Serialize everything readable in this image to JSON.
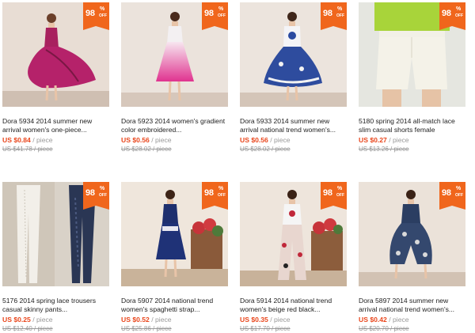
{
  "badge": {
    "number": "98",
    "percent": "%",
    "off": "OFF"
  },
  "unit": "/ piece",
  "products": [
    {
      "title": "Dora 5934 2014 summer new\narrival women's one-piece...",
      "price": "US $0.84",
      "original": "US $41.78 / piece",
      "garment": "magenta-dress"
    },
    {
      "title": "Dora 5923 2014 women's gradient\ncolor embroidered...",
      "price": "US $0.56",
      "original": "US $28.02 / piece",
      "garment": "pink-gradient-dress"
    },
    {
      "title": "Dora 5933 2014 summer new\narrival national trend women's...",
      "price": "US $0.56",
      "original": "US $28.02 / piece",
      "garment": "blue-print-skirt"
    },
    {
      "title": "5180 spring 2014 all-match lace\nslim casual shorts female",
      "price": "US $0.27",
      "original": "US $13.26 / piece",
      "garment": "white-shorts"
    },
    {
      "title": "5176 2014 spring lace trousers\ncasual skinny pants...",
      "price": "US $0.25",
      "original": "US $12.40 / piece",
      "garment": "skinny-pants"
    },
    {
      "title": "Dora 5907 2014 national trend\nwomen's spaghetti strap...",
      "price": "US $0.52",
      "original": "US $25.86 / piece",
      "garment": "navy-strap-dress"
    },
    {
      "title": "Dora 5914 2014 national trend\nwomen's beige red black...",
      "price": "US $0.35",
      "original": "US $17.70 / piece",
      "garment": "red-print-pants"
    },
    {
      "title": "Dora 5897 2014 summer new\narrival national trend women's...",
      "price": "US $0.42",
      "original": "US $20.70 / piece",
      "garment": "harem-jumpsuit"
    }
  ]
}
